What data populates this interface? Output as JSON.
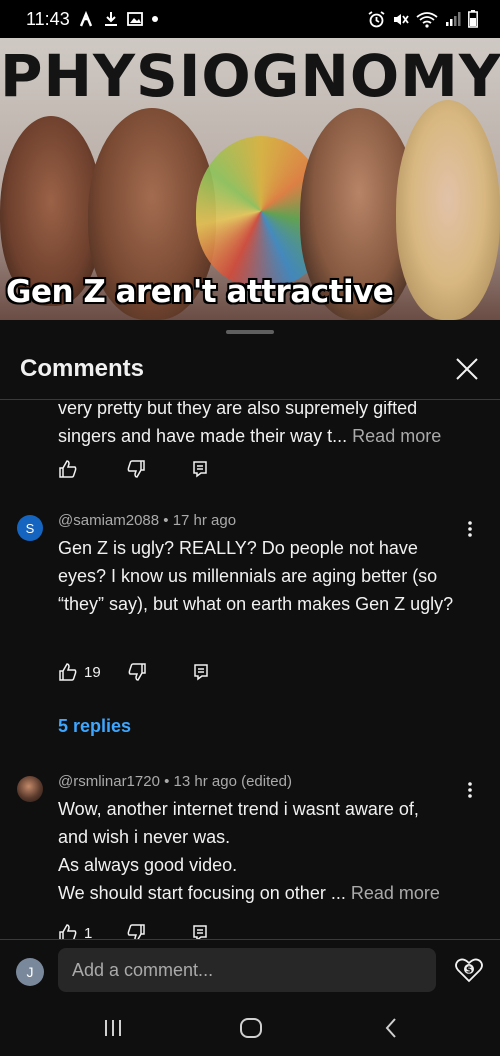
{
  "status_bar": {
    "time": "11:43",
    "left_icons": [
      "strava-icon",
      "download-icon",
      "image-icon",
      "dot-icon"
    ],
    "right_icons": [
      "alarm-icon",
      "mute-icon",
      "wifi-icon",
      "signal-icon",
      "battery-icon"
    ]
  },
  "video_thumbnail": {
    "title_text": "PHYSIOGNOMY",
    "caption_text": "Gen Z aren't attractive"
  },
  "comments_sheet": {
    "title": "Comments",
    "comments": [
      {
        "partial_text": "very pretty but they are also supremely gifted singers and have made their way t...",
        "read_more": "Read more"
      },
      {
        "avatar_letter": "S",
        "avatar_color": "#1565c0",
        "handle": "@samiam2088",
        "time": "17 hr ago",
        "text": "Gen Z is ugly? REALLY? Do people not have eyes? I know us millennials are aging better (so “they” say), but what on earth makes Gen Z ugly?",
        "likes": "19",
        "replies_label": "5 replies"
      },
      {
        "handle": "@rsmlinar1720",
        "time": "13 hr ago (edited)",
        "lines": [
          "Wow, another internet trend i wasnt aware of,",
          "and wish i never was.",
          "As always good video.",
          "We should start focusing on other ..."
        ],
        "read_more": "Read more",
        "likes": "1"
      }
    ]
  },
  "composer": {
    "avatar_letter": "J",
    "placeholder": "Add a comment..."
  },
  "colors": {
    "background": "#0f0f0f",
    "link": "#3ea6ff",
    "secondary_text": "#aaaaaa"
  }
}
